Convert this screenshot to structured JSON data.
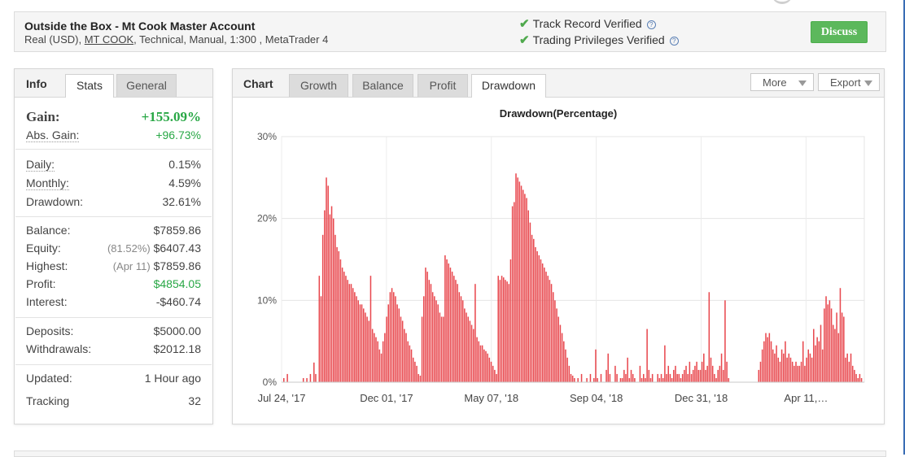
{
  "account": {
    "title": "Outside the Box - Mt Cook Master Account",
    "sub_prefix": "Real (USD),",
    "sub_link": "MT COOK",
    "sub_suffix": ", Technical, Manual, 1:300 , MetaTrader 4"
  },
  "verification": {
    "track_record": "Track Record Verified",
    "trading_privileges": "Trading Privileges Verified"
  },
  "discuss_label": "Discuss",
  "info_panel": {
    "heading": "Info",
    "tabs": [
      "Stats",
      "General"
    ],
    "active_tab": "Stats",
    "gain": {
      "label": "Gain:",
      "value": "+155.09%"
    },
    "abs_gain": {
      "label": "Abs. Gain:",
      "value": "+96.73%"
    },
    "daily": {
      "label": "Daily:",
      "value": "0.15%"
    },
    "monthly": {
      "label": "Monthly:",
      "value": "4.59%"
    },
    "drawdown": {
      "label": "Drawdown:",
      "value": "32.61%"
    },
    "balance": {
      "label": "Balance:",
      "value": "$7859.86"
    },
    "equity": {
      "label": "Equity:",
      "note": "(81.52%)",
      "value": "$6407.43"
    },
    "highest": {
      "label": "Highest:",
      "note": "(Apr 11)",
      "value": "$7859.86"
    },
    "profit": {
      "label": "Profit:",
      "value": "$4854.05"
    },
    "interest": {
      "label": "Interest:",
      "value": "-$460.74"
    },
    "deposits": {
      "label": "Deposits:",
      "value": "$5000.00"
    },
    "withdrawals": {
      "label": "Withdrawals:",
      "value": "$2012.18"
    },
    "updated": {
      "label": "Updated:",
      "value": "1 Hour ago"
    },
    "tracking": {
      "label": "Tracking",
      "value": "32"
    }
  },
  "chart_panel": {
    "heading": "Chart",
    "tabs": [
      "Growth",
      "Balance",
      "Profit",
      "Drawdown"
    ],
    "active_tab": "Drawdown",
    "more_label": "More",
    "export_label": "Export"
  },
  "colors": {
    "accent_green": "#28a745",
    "discuss_green": "#5cb85c",
    "bar_red": "#e8474d",
    "check_green": "#4fa94d"
  },
  "chart_data": {
    "type": "bar",
    "title": "Drawdown(Percentage)",
    "y_ticks": [
      "0%",
      "10%",
      "20%",
      "30%"
    ],
    "ylim": [
      0,
      30
    ],
    "x_labels": [
      "Jul 24, '17",
      "Dec 01, '17",
      "May 07, '18",
      "Sep 04, '18",
      "Dec 31, '18",
      "Apr 11,…"
    ],
    "grid": true,
    "series": [
      {
        "values": [
          0.5,
          0.0,
          1.0,
          0.0,
          0.0,
          0.0,
          0.0,
          0.0,
          0.0,
          0.0,
          0.0,
          0.5,
          0.0,
          0.5,
          0.0,
          1.0,
          0.0,
          2.4,
          1.0,
          0.0,
          13.0,
          10.5,
          18.0,
          21.0,
          25.0,
          24.0,
          20.5,
          21.5,
          20.0,
          18.0,
          16.5,
          16.0,
          15.0,
          14.0,
          13.5,
          13.0,
          12.5,
          12.0,
          12.0,
          11.5,
          11.0,
          10.5,
          10.0,
          9.5,
          9.5,
          9.0,
          8.5,
          8.0,
          7.5,
          13.0,
          6.5,
          6.0,
          5.5,
          5.0,
          4.0,
          3.5,
          5.0,
          6.0,
          8.0,
          9.5,
          11.0,
          11.5,
          11.0,
          10.5,
          9.5,
          9.0,
          8.0,
          7.5,
          6.5,
          6.0,
          5.0,
          4.5,
          4.0,
          3.0,
          2.5,
          2.0,
          1.0,
          0.8,
          8.0,
          10.5,
          14.0,
          13.5,
          12.5,
          12.0,
          11.0,
          10.5,
          10.0,
          9.5,
          8.5,
          8.0,
          8.0,
          15.5,
          15.0,
          14.5,
          14.0,
          13.5,
          13.0,
          12.5,
          12.0,
          11.0,
          10.5,
          10.0,
          9.0,
          8.5,
          8.0,
          7.5,
          7.0,
          6.5,
          12.0,
          5.5,
          5.0,
          4.5,
          4.5,
          4.0,
          3.8,
          3.5,
          3.0,
          2.5,
          2.0,
          1.5,
          1.0,
          13.0,
          12.5,
          13.0,
          12.8,
          12.5,
          12.3,
          12.0,
          15.0,
          21.5,
          22.0,
          25.5,
          25.0,
          24.5,
          24.0,
          23.5,
          23.0,
          22.5,
          21.0,
          19.5,
          18.0,
          17.5,
          16.5,
          16.0,
          15.5,
          15.0,
          14.5,
          14.0,
          13.5,
          13.0,
          12.5,
          12.0,
          11.0,
          10.0,
          9.0,
          8.0,
          7.0,
          6.0,
          5.0,
          4.0,
          3.0,
          2.0,
          1.0,
          0.8,
          0.5,
          0.0,
          0.5,
          0.0,
          1.0,
          0.0,
          0.0,
          0.5,
          0.0,
          1.0,
          0.0,
          0.5,
          4.0,
          0.5,
          0.0,
          1.0,
          0.0,
          0.0,
          1.5,
          3.5,
          1.0,
          0.0,
          0.0,
          2.0,
          1.0,
          0.0,
          0.5,
          0.5,
          1.5,
          1.0,
          3.0,
          0.5,
          1.5,
          1.0,
          0.5,
          0.0,
          0.0,
          2.0,
          0.5,
          1.0,
          0.5,
          6.5,
          1.5,
          0.5,
          1.0,
          0.0,
          0.0,
          1.0,
          0.5,
          1.0,
          0.5,
          4.5,
          1.0,
          2.0,
          1.0,
          0.5,
          1.5,
          2.0,
          1.0,
          1.0,
          0.5,
          1.0,
          1.5,
          2.0,
          1.0,
          2.5,
          1.0,
          1.5,
          2.0,
          2.5,
          1.5,
          1.5,
          2.5,
          3.5,
          1.5,
          2.0,
          11.0,
          3.0,
          2.0,
          1.0,
          0.5,
          1.5,
          2.0,
          3.5,
          1.5,
          10.0,
          2.5,
          0.5,
          0.0,
          0.0,
          0.0,
          0.0,
          0.0,
          0.0,
          0.0,
          0.0,
          0.0,
          0.0,
          0.0,
          0.0,
          0.0,
          0.0,
          0.0,
          0.0,
          1.5,
          2.5,
          4.0,
          5.0,
          6.0,
          5.5,
          6.0,
          5.0,
          4.0,
          3.5,
          4.5,
          3.0,
          2.5,
          4.0,
          3.5,
          5.0,
          3.0,
          3.5,
          3.0,
          2.5,
          2.0,
          2.5,
          2.0,
          2.0,
          2.5,
          5.0,
          2.0,
          3.0,
          4.0,
          3.5,
          3.0,
          6.5,
          4.5,
          5.5,
          5.0,
          7.0,
          4.0,
          9.0,
          10.5,
          9.5,
          10.0,
          9.0,
          7.0,
          6.5,
          8.5,
          6.0,
          11.5,
          8.5,
          8.0,
          3.0,
          3.5,
          2.5,
          3.5,
          2.0,
          1.5,
          1.0,
          0.5,
          1.0,
          0.5
        ]
      }
    ]
  }
}
